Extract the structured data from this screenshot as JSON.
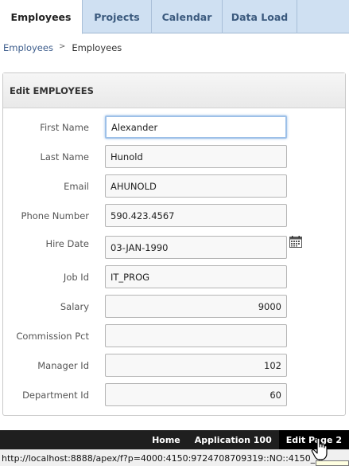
{
  "tabs": [
    {
      "label": "Employees",
      "active": true
    },
    {
      "label": "Projects",
      "active": false
    },
    {
      "label": "Calendar",
      "active": false
    },
    {
      "label": "Data Load",
      "active": false
    }
  ],
  "breadcrumb": {
    "parent": "Employees",
    "separator": ">",
    "current": "Employees"
  },
  "region": {
    "title": "Edit EMPLOYEES"
  },
  "form": {
    "first_name": {
      "label": "First Name",
      "value": "Alexander"
    },
    "last_name": {
      "label": "Last Name",
      "value": "Hunold"
    },
    "email": {
      "label": "Email",
      "value": "AHUNOLD"
    },
    "phone_number": {
      "label": "Phone Number",
      "value": "590.423.4567"
    },
    "hire_date": {
      "label": "Hire Date",
      "value": "03-JAN-1990"
    },
    "job_id": {
      "label": "Job Id",
      "value": "IT_PROG"
    },
    "salary": {
      "label": "Salary",
      "value": "9000"
    },
    "commission_pct": {
      "label": "Commission Pct",
      "value": ""
    },
    "manager_id": {
      "label": "Manager Id",
      "value": "102"
    },
    "department_id": {
      "label": "Department Id",
      "value": "60"
    }
  },
  "developer_toolbar": {
    "home": "Home",
    "application": "Application 100",
    "edit_page": "Edit Page 2"
  },
  "status_bar": {
    "url": "http://localhost:8888/apex/f?p=4000:4150:9724708709319::NO::4150_..."
  },
  "icons": {
    "calendar": "calendar-icon",
    "cursor": "hand-pointer-icon"
  },
  "colors": {
    "tab_bar": "#cfe0f2",
    "tab_text": "#3b5a7e",
    "link": "#3d5d8c",
    "focus_border": "#9dc0e8",
    "dev_bar": "#1f1f1f"
  }
}
